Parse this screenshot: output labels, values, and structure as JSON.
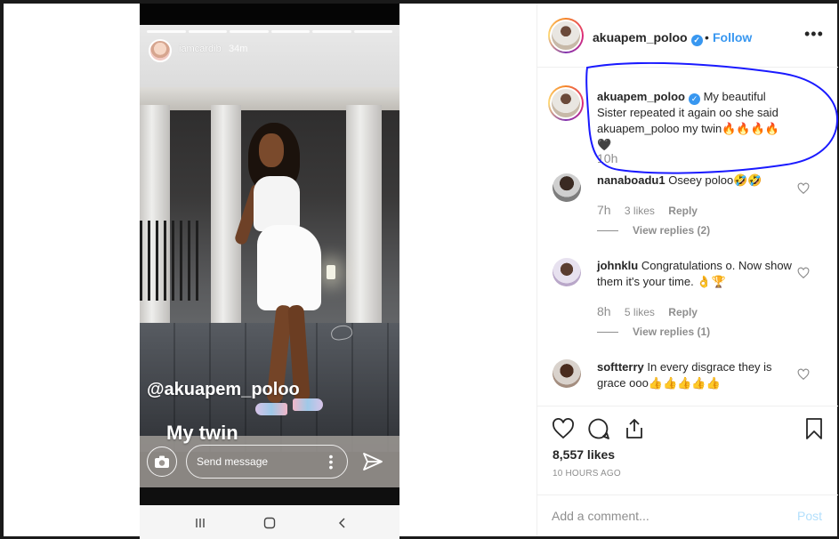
{
  "story": {
    "username": "iamcardib",
    "time": "34m",
    "mention": "@akuapem_poloo",
    "caption": "My twin",
    "send_placeholder": "Send message"
  },
  "post": {
    "author": "akuapem_poloo",
    "dot": "•",
    "follow": "Follow",
    "more": "•••",
    "caption": {
      "username": "akuapem_poloo",
      "text": "My beautiful Sister repeated it again oo she said akuapem_poloo my twin🔥🔥🔥🔥🖤",
      "time": "10h"
    },
    "comments": [
      {
        "username": "nanaboadu1",
        "text": "Oseey poloo🤣🤣",
        "time": "7h",
        "likes": "3 likes",
        "reply": "Reply",
        "view_replies": "View replies (2)"
      },
      {
        "username": "johnklu",
        "text": "Congratulations o. Now show them it's your time. 👌🏆",
        "time": "8h",
        "likes": "5 likes",
        "reply": "Reply",
        "view_replies": "View replies (1)"
      },
      {
        "username": "softterry",
        "text": "In every disgrace they is grace ooo👍👍👍👍👍"
      }
    ],
    "likes": "8,557 likes",
    "timestamp": "10 HOURS AGO",
    "add_comment_placeholder": "Add a comment...",
    "post_label": "Post"
  },
  "colors": {
    "link_blue": "#3897f0",
    "annotation_blue": "#1a1aff"
  }
}
